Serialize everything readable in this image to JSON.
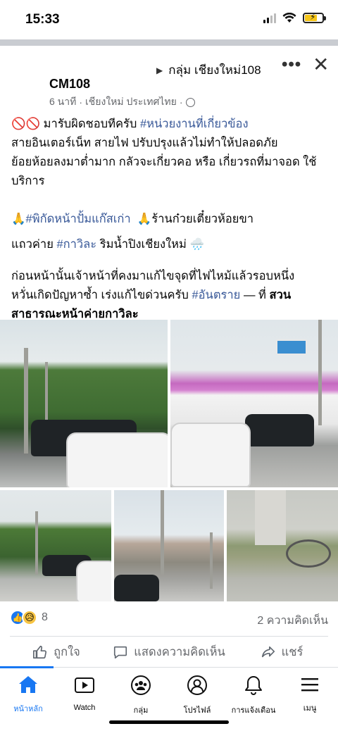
{
  "status_bar": {
    "time": "15:33"
  },
  "post": {
    "group_name": "กลุ่ม เชียงใหม่108",
    "author": "CM108",
    "meta_time": "6 นาที",
    "meta_location": "เชียงใหม่ ประเทศไทย",
    "line1_emoji": "🚫🚫",
    "line1_text": " มารับผิดชอบทีครับ ",
    "line1_tag": "#หน่วยงานที่เกี่ยวข้อง",
    "line2": "สายอินเตอร์เน็ท สายไฟ ปรับปรุงแล้วไม่ทำให้ปลอดภัย",
    "line3": "ย้อยห้อยลงมาต่ำมาก กลัวจะเกี่ยวคอ หรือ เกี่ยวรถที่มาจอด ใช้",
    "line4": "บริการ",
    "line5_emoji1": "🙏",
    "line5_tag": "#พิกัดหน้าปั้มแก๊สเก่า",
    "line5_emoji2": "🙏",
    "line5_text": "ร้านก๋วยเตี๋ยวห้อยขา",
    "line6_text1": "แถวค่าย ",
    "line6_tag": "#กาวิละ",
    "line6_text2": " ริมน้ำปิงเชียงใหม่ ",
    "line6_emoji": "🌧️",
    "line7": "ก่อนหน้านั้นเจ้าหน้าที่คงมาแก้ไขจุดที่ไฟไหม้แล้วรอบหนึ่ง",
    "line8_text": "หวั่นเกิดปัญหาซ้ำ เร่งแก้ไขด่วนครับ ",
    "line8_tag": "#อันตราย",
    "line8_sep": " — ที่ ",
    "line8_place": "สวน",
    "line9_place": "สาธารณะหน้าค่ายกาวิละ"
  },
  "reactions": {
    "like_icon": "👍",
    "sad_icon": "😥",
    "count": "8",
    "comments": "2 ความคิดเห็น"
  },
  "actions": {
    "like": "ถูกใจ",
    "comment": "แสดงความคิดเห็น",
    "share": "แชร์"
  },
  "nav": {
    "home": "หน้าหลัก",
    "watch": "Watch",
    "groups": "กลุ่ม",
    "profile": "โปรไฟล์",
    "notifications": "การแจ้งเตือน",
    "menu": "เมนู"
  },
  "colors": {
    "accent": "#1877f2",
    "hashtag": "#385898",
    "muted": "#65676b"
  }
}
